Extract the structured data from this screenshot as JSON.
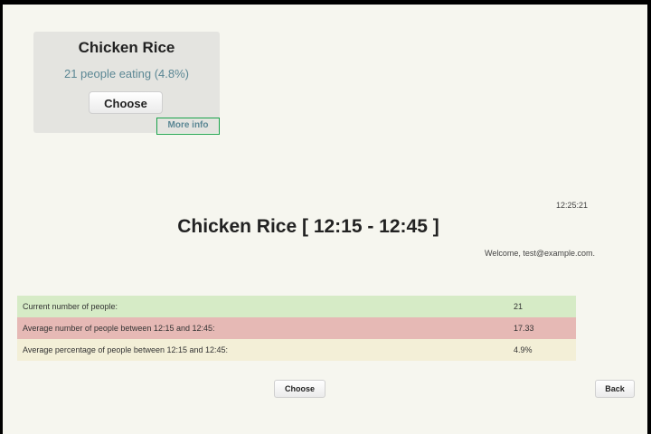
{
  "menu_card": {
    "title": "Chicken Rice",
    "subtitle": "21 people eating (4.8%)",
    "choose_label": "Choose",
    "more_info_label": "More info"
  },
  "header": {
    "clock": "12:25:21",
    "title": "Chicken Rice [ 12:15 - 12:45 ]",
    "welcome": "Welcome, test@example.com."
  },
  "stats": [
    {
      "label": "Current number of people:",
      "value": "21",
      "color": "#d6ebc6"
    },
    {
      "label": "Average number of people between 12:15 and 12:45:",
      "value": "17.33",
      "color": "#e6b9b5"
    },
    {
      "label": "Average percentage of people between 12:15 and 12:45:",
      "value": "4.9%",
      "color": "#f3efd7"
    }
  ],
  "actions": {
    "choose_label": "Choose",
    "back_label": "Back"
  }
}
